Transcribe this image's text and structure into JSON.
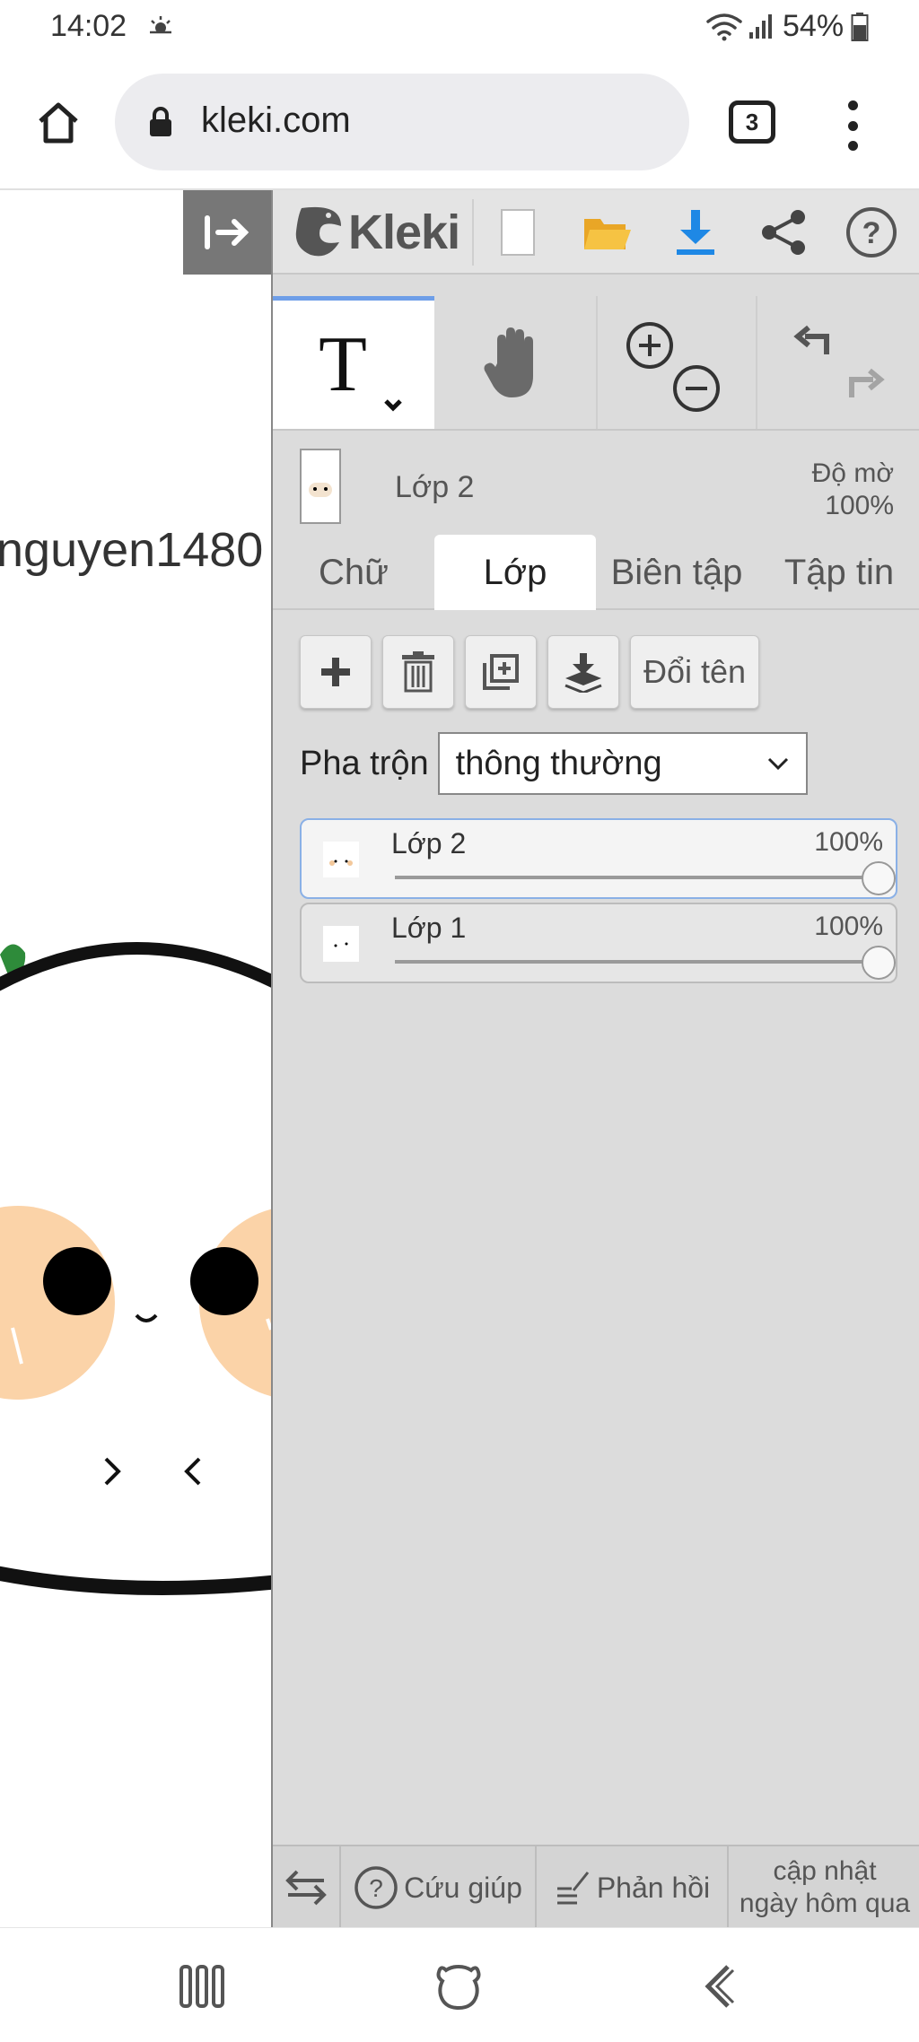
{
  "status_bar": {
    "time": "14:02",
    "battery": "54%",
    "icons": [
      "weather-icon",
      "wifi-icon",
      "signal-icon",
      "battery-icon"
    ]
  },
  "browser": {
    "url": "kleki.com",
    "tab_count": "3",
    "icons": [
      "home-icon",
      "lock-icon",
      "more-vert-icon"
    ]
  },
  "canvas": {
    "username_text": "nguyen1480"
  },
  "app": {
    "logo": "Kleki",
    "accent_color": "#1e88e5",
    "toolbar_icons": [
      "new-file-icon",
      "open-folder-icon",
      "download-icon",
      "share-icon",
      "help-icon"
    ],
    "tools": [
      "text-tool-icon",
      "hand-tool-icon",
      "zoom-in-icon",
      "zoom-out-icon",
      "undo-icon",
      "redo-icon"
    ],
    "current_layer": {
      "name": "Lớp 2",
      "opacity_label": "Độ mờ",
      "opacity_value": "100%"
    },
    "tabs": [
      {
        "label": "Chữ",
        "active": false
      },
      {
        "label": "Lớp",
        "active": true
      },
      {
        "label": "Biên tập",
        "active": false
      },
      {
        "label": "Tập tin",
        "active": false
      }
    ],
    "layer_actions": {
      "rename_label": "Đổi tên",
      "icons": [
        "add-layer-icon",
        "delete-layer-icon",
        "duplicate-layer-icon",
        "merge-down-icon"
      ]
    },
    "blend": {
      "label": "Pha trộn",
      "value": "thông thường"
    },
    "layers": [
      {
        "name": "Lớp 2",
        "opacity": "100%",
        "opacity_fraction": 1.0,
        "selected": true
      },
      {
        "name": "Lớp 1",
        "opacity": "100%",
        "opacity_fraction": 1.0,
        "selected": false
      }
    ],
    "bottom_bar": {
      "help_label": "Cứu giúp",
      "feedback_label": "Phản hồi",
      "update_line1": "cập nhật",
      "update_line2": "ngày hôm qua"
    }
  },
  "nav_bar": {
    "icons": [
      "recents-icon",
      "home-bear-icon",
      "back-icon"
    ]
  }
}
